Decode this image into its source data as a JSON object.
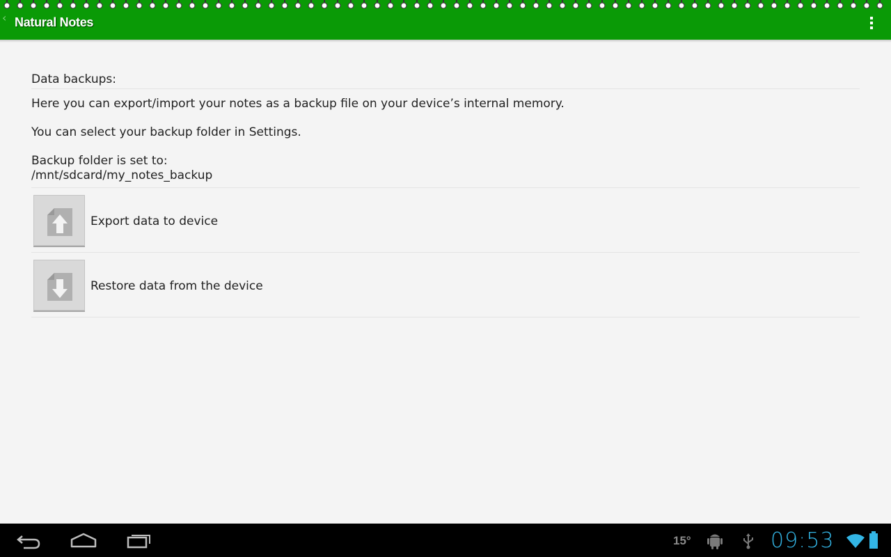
{
  "actionbar": {
    "title": "Natural Notes",
    "color": "#0a9a06"
  },
  "content": {
    "heading": "Data backups:",
    "description": "Here you can export/import your notes as a backup file on your device’s internal memory.",
    "settings_hint": "You can select your backup folder in Settings.",
    "folder_label": "Backup folder is set to:",
    "folder_path": "/mnt/sdcard/my_notes_backup",
    "actions": [
      {
        "label": "Export data to device",
        "icon": "sd-card-upload-icon"
      },
      {
        "label": "Restore data from the device",
        "icon": "sd-card-download-icon"
      }
    ]
  },
  "system_bar": {
    "temperature": "15°",
    "clock": "09:53",
    "accent_color": "#33b5e5"
  }
}
